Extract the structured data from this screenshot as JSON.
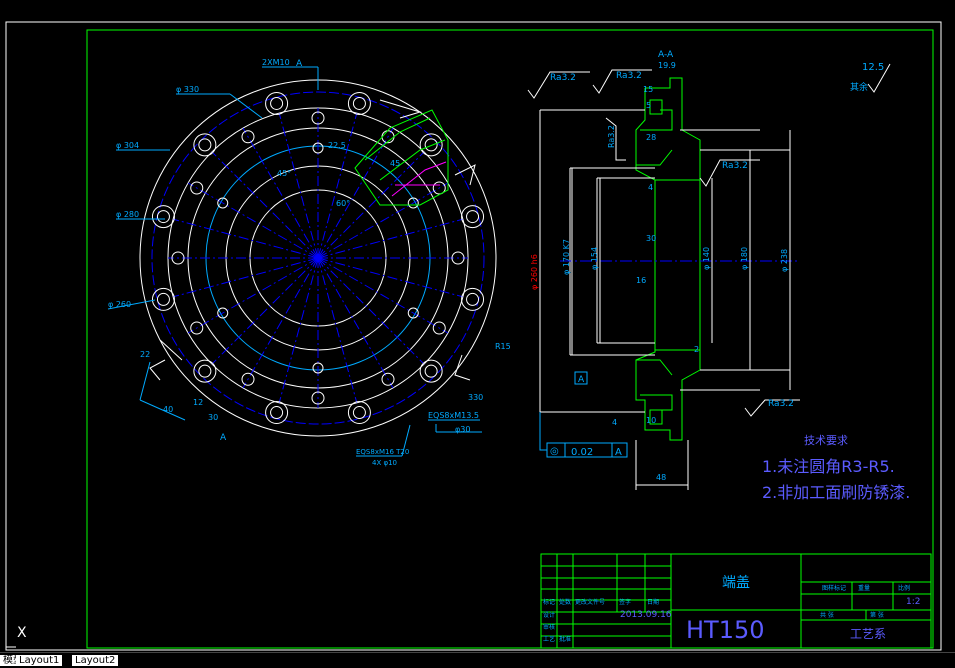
{
  "colors": {
    "background": "#000000",
    "frame": "#00ff00",
    "dim": "#00aaff",
    "center": "#0000ff",
    "geometry": "#ffffff",
    "section": "#00ff00",
    "hatch": "#ff00ff",
    "accent": "#ff0000",
    "note": "#5b5bff"
  },
  "front_view": {
    "label_hole": "2XM10",
    "label_a_top": "A",
    "label_a_bottom": "A",
    "dia_330": "φ 330",
    "dia_304": "φ 304",
    "dia_280": "φ 280",
    "dia_260": "φ 260",
    "ang_22": "22.5",
    "ang_45": "45°",
    "ang_60": "60°",
    "r_ang": "45",
    "label_r15": "R15",
    "label_330": "330",
    "label_22": "22",
    "label_40": "40",
    "label_12": "12",
    "label_30": "30",
    "label_thread": "EQS8xM13.5",
    "label_phi30": "φ30",
    "label_bolt1": "EQS8xM16 T20",
    "label_bolt2": "4X φ10"
  },
  "section_view": {
    "title": "A-A",
    "dim_19_9": "19.9",
    "ra_left": "Ra3.2",
    "ra_top": "Ra3.2",
    "ra_side": "Ra3.2",
    "ra_mid": "Ra3.2",
    "ra_bottom": "Ra3.2",
    "dim_15": "15",
    "dim_5": "5",
    "dim_28": "28",
    "dim_4_top": "4",
    "dim_30": "30",
    "dim_16": "16",
    "dim_ring": "φ 260 h6",
    "dim_bore": "φ 170 K7",
    "dim_154": "φ 154",
    "dim_140": "φ 140",
    "dim_180": "φ 180",
    "dim_238": "φ 238",
    "dim_2": "2",
    "dim_4_bot": "4",
    "dim_10": "10",
    "dim_48": "48",
    "datum": "A",
    "tol_symbol": "◎",
    "tol_value": "0.02",
    "tol_datum": "A"
  },
  "roughness_note": {
    "value": "12.5",
    "suffix": "其余"
  },
  "tech_req": {
    "title": "技术要求",
    "item1": "1.未注圆角R3-R5.",
    "item2": "2.非加工面刷防锈漆."
  },
  "title_block": {
    "part_name": "端盖",
    "material": "HT150",
    "date": "2013.09.16",
    "scale": "1:2",
    "dept": "工艺系",
    "small_labels": [
      "标记",
      "处数",
      "更改文件号",
      "签字",
      "日期",
      "设计",
      "审核",
      "工艺",
      "批准"
    ],
    "right_labels": [
      "图样标记",
      "重量",
      "比例",
      "共 张",
      "第 张"
    ]
  },
  "tabs": {
    "model": "模型",
    "layout1": "Layout1",
    "layout2": "Layout2"
  },
  "ucs": {
    "label": "X"
  }
}
